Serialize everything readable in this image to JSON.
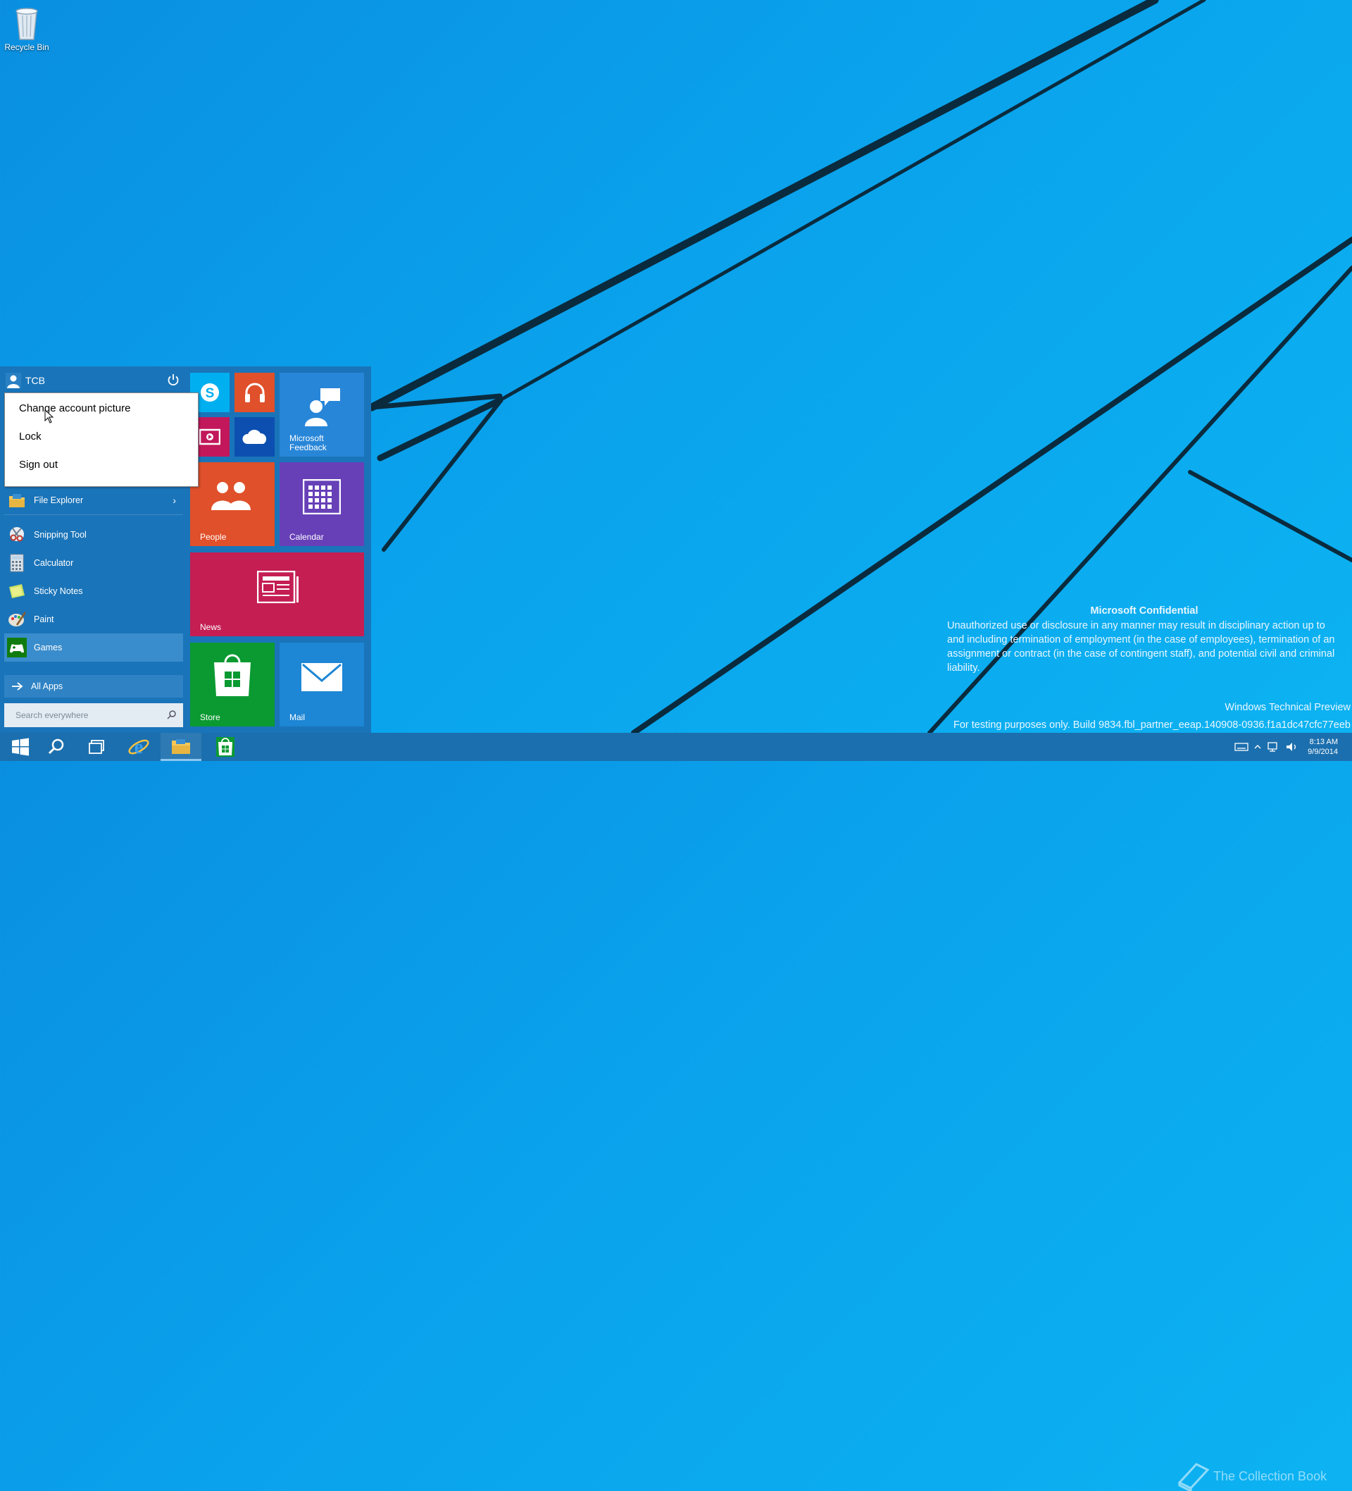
{
  "desktop": {
    "recycle_bin_label": "Recycle Bin",
    "confidential_title": "Microsoft Confidential",
    "confidential_text": "Unauthorized use or disclosure in any manner may result in disciplinary action up to and including termination of employment (in the case of employees), termination of an assignment or contract (in the case of contingent staff), and potential civil and criminal liability.",
    "edition": "Windows Technical Preview",
    "build": "For testing purposes only. Build 9834.fbl_partner_eeap.140908-0936.f1a1dc47cfc77eeb"
  },
  "start": {
    "user_name": "TCB",
    "account_menu": {
      "change_picture": "Change account picture",
      "lock": "Lock",
      "sign_out": "Sign out"
    },
    "apps": [
      {
        "label": "File Explorer"
      },
      {
        "label": "Snipping Tool"
      },
      {
        "label": "Calculator"
      },
      {
        "label": "Sticky Notes"
      },
      {
        "label": "Paint"
      },
      {
        "label": "Games"
      }
    ],
    "all_apps_label": "All Apps",
    "search_placeholder": "Search everywhere",
    "tiles": {
      "feedback": "Microsoft\nFeedback",
      "people": "People",
      "calendar": "Calendar",
      "news": "News",
      "store": "Store",
      "mail": "Mail"
    }
  },
  "taskbar": {
    "time": "8:13 AM",
    "date": "9/9/2014",
    "watermark": "The Collection Book"
  },
  "colors": {
    "start_bg": "#1a74b9",
    "taskbar_bg": "#1c6fae",
    "skype": "#00aff0",
    "music": "#e0502a",
    "video": "#c2185b",
    "onedrive": "#0c4fb0",
    "feedback": "#2886d8",
    "people": "#e0502a",
    "calendar": "#6740b8",
    "news": "#c41e53",
    "store": "#0a9a31",
    "mail": "#1d86d5"
  }
}
